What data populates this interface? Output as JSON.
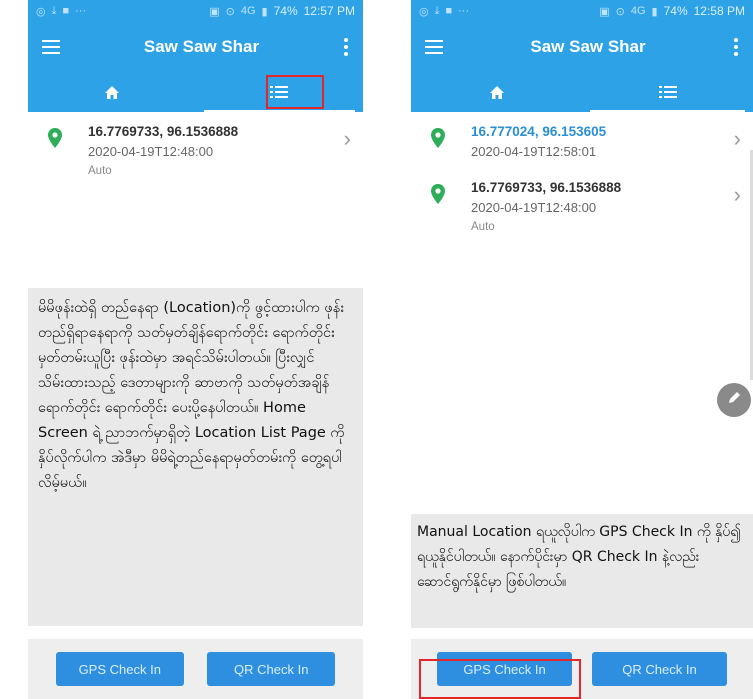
{
  "status_left": {
    "icons": [
      "whatsapp-icon",
      "download-icon",
      "video-icon",
      "more-dots"
    ],
    "overflow_text": "···"
  },
  "screens": [
    {
      "status_time": "12:57 PM",
      "battery": "74%",
      "network": "4G",
      "app_title": "Saw Saw Shar",
      "active_tab": "list",
      "items": [
        {
          "coords": "16.7769733, 96.1536888",
          "timestamp": "2020-04-19T12:48:00",
          "mode": "Auto"
        }
      ],
      "note": "မိမိဖုန်းထဲရှိ တည်နေရာ (Location)ကို ဖွင့်ထားပါက ဖုန်းတည်ရှိရာနေရာကို သတ်မှတ်ချိန်ရောက်တိုင်း ရောက်တိုင်း မှတ်တမ်းယူပြီး ဖုန်းထဲမှာ အရင်သိမ်းပါတယ်။ ပြီးလျှင် သိမ်းထားသည့် ဒေတာများကို ဆာဗာကို သတ်မှတ်အချိန် ရောက်တိုင်း ရောက်တိုင်း ပေးပို့နေပါတယ်။ Home Screen ရဲ့ ညာဘက်မှာရှိတဲ့ Location List Page ကို နှိပ်လိုက်ပါက အဲဒီမှာ မိမိရဲ့တည်နေရာမှတ်တမ်းကို တွေ့ရပါလိမ့်မယ်။",
      "gps_button": "GPS Check In",
      "qr_button": "QR Check In"
    },
    {
      "status_time": "12:58 PM",
      "battery": "74%",
      "network": "4G",
      "app_title": "Saw Saw Shar",
      "active_tab": "list",
      "items": [
        {
          "coords": "16.777024, 96.153605",
          "timestamp": "2020-04-19T12:58:01",
          "mode": ""
        },
        {
          "coords": "16.7769733, 96.1536888",
          "timestamp": "2020-04-19T12:48:00",
          "mode": "Auto"
        }
      ],
      "note": "Manual Location ရယူလိုပါက GPS Check In ကို နှိပ်၍ ရယူနိုင်ပါတယ်။ နောက်ပိုင်းမှာ QR Check In နဲ့လည်း ဆောင်ရွက်နိုင်မှာ ဖြစ်ပါတယ်။",
      "gps_button": "GPS Check In",
      "qr_button": "QR Check In"
    }
  ],
  "colors": {
    "primary": "#2da2e6",
    "button": "#2e8fe0",
    "highlight": "#e3262b",
    "pin": "#2fae5a",
    "note_bg": "#e9e9e9"
  }
}
